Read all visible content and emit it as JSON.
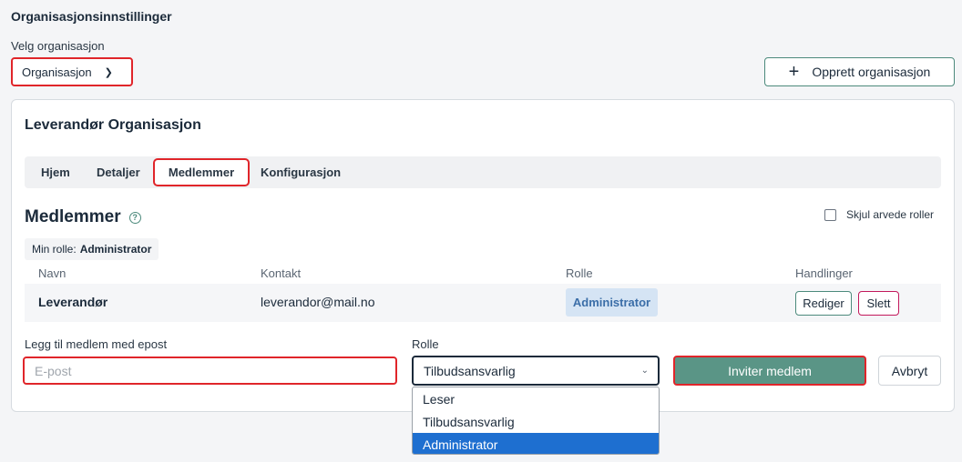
{
  "page": {
    "title": "Organisasjonsinnstillinger"
  },
  "org_select": {
    "label": "Velg organisasjon",
    "value": "Organisasjon"
  },
  "create_button": {
    "label": "Opprett organisasjon"
  },
  "card": {
    "title": "Leverandør Organisasjon",
    "tabs": [
      {
        "label": "Hjem"
      },
      {
        "label": "Detaljer"
      },
      {
        "label": "Medlemmer",
        "active": true
      },
      {
        "label": "Konfigurasjon"
      }
    ]
  },
  "members": {
    "title": "Medlemmer",
    "hide_inherited_label": "Skjul arvede roller",
    "my_role_label": "Min rolle:",
    "my_role_value": "Administrator",
    "columns": [
      "Navn",
      "Kontakt",
      "Rolle",
      "Handlinger"
    ],
    "rows": [
      {
        "name": "Leverandør",
        "contact": "leverandor@mail.no",
        "role": "Administrator",
        "edit_label": "Rediger",
        "delete_label": "Slett"
      }
    ]
  },
  "add_member": {
    "email_label": "Legg til medlem med epost",
    "email_placeholder": "E-post",
    "role_label": "Rolle",
    "role_value": "Tilbudsansvarlig",
    "role_options": [
      "Leser",
      "Tilbudsansvarlig",
      "Administrator"
    ],
    "highlighted_option": "Administrator",
    "invite_label": "Inviter medlem",
    "cancel_label": "Avbryt"
  },
  "colors": {
    "accent": "#5a9586",
    "highlight_border": "#e0252a",
    "selected_option": "#1e6fd0",
    "role_badge": "#d5e4f4"
  }
}
